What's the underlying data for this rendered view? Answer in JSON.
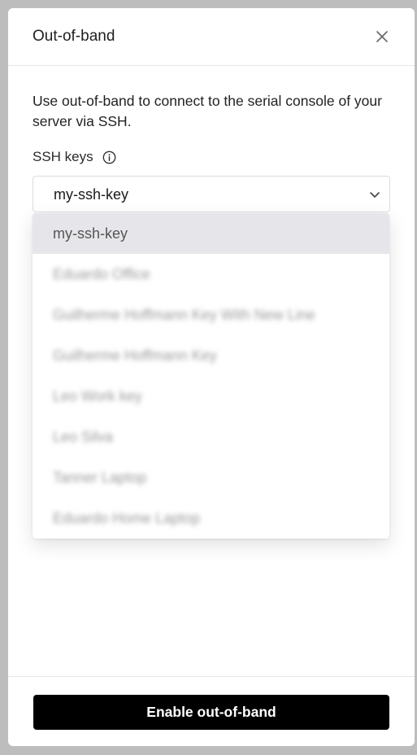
{
  "modal": {
    "title": "Out-of-band",
    "description": "Use out-of-band to connect to the serial console of your server via SSH."
  },
  "ssh_keys": {
    "label": "SSH keys",
    "selected_value": "my-ssh-key",
    "options": [
      "my-ssh-key",
      "Eduardo Office",
      "Guilherme Hoffmann Key With New Line",
      "Guilherme Hoffmann Key",
      "Leo Work key",
      "Leo Silva",
      "Tanner Laptop",
      "Eduardo Home Laptop"
    ]
  },
  "footer": {
    "primary_button_label": "Enable out-of-band"
  },
  "icons": {
    "close": "close-icon",
    "info": "info-icon",
    "chevron": "chevron-down-icon"
  },
  "colors": {
    "primary_button_bg": "#000000",
    "selected_option_bg": "#e6e6ea"
  }
}
